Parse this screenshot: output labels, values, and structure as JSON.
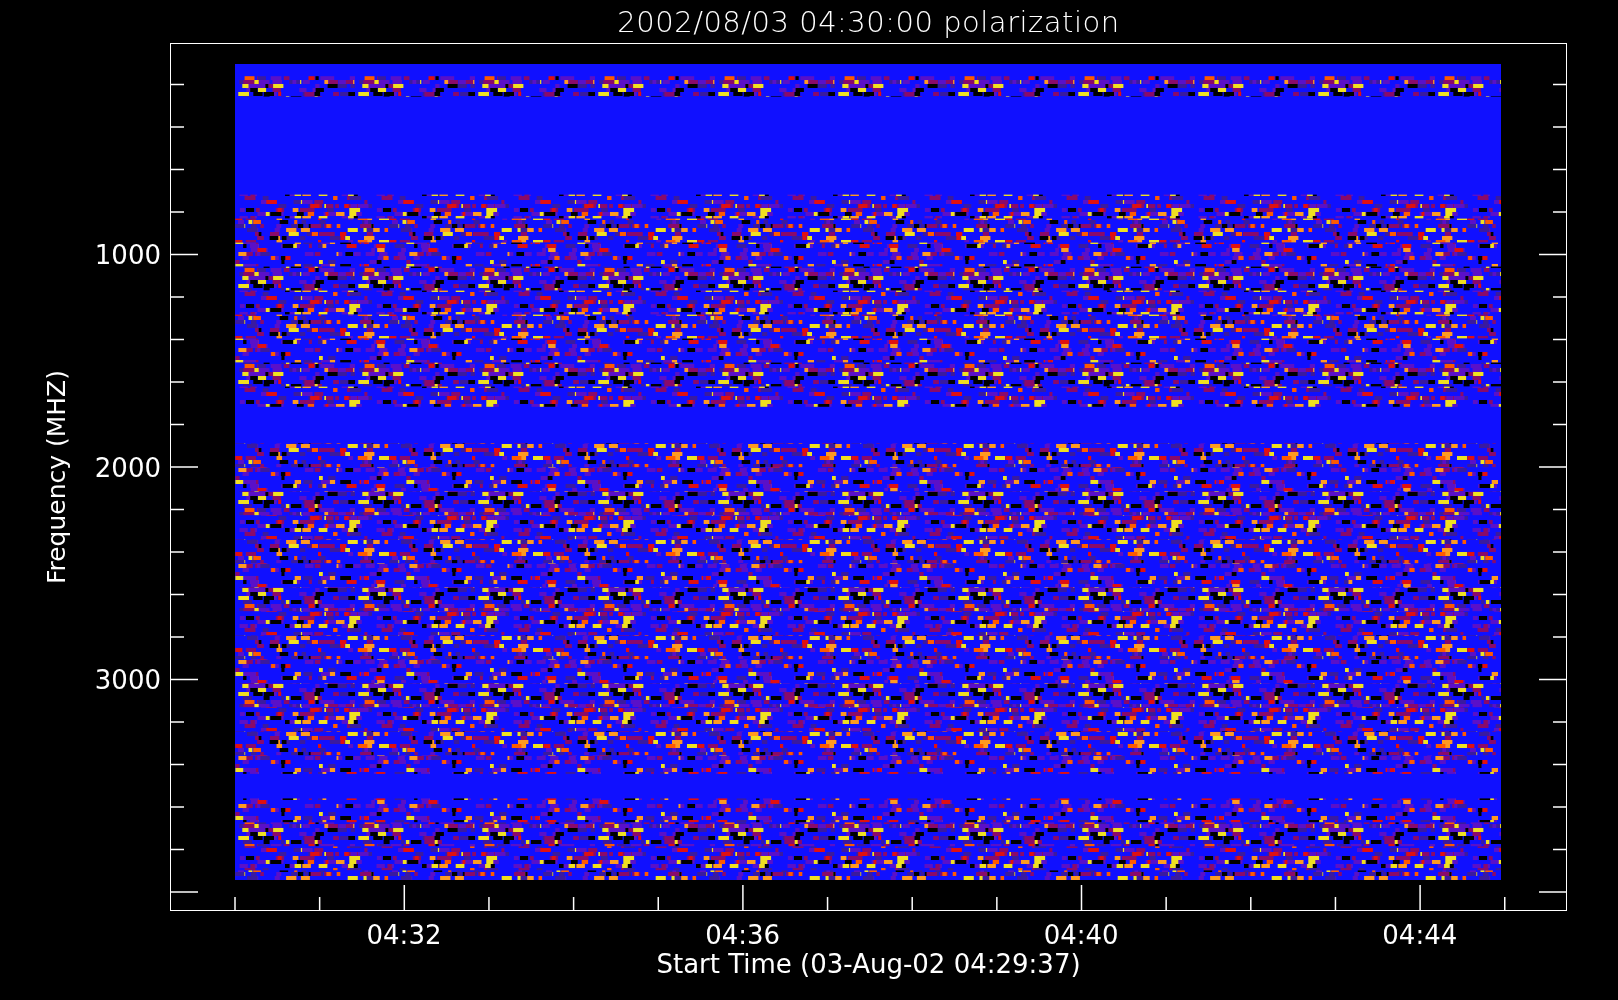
{
  "title": "2002/08/03 04:30:00 polarization",
  "y_axis": {
    "label": "Frequency (MHZ)",
    "tick_labels": [
      "1000",
      "2000",
      "3000"
    ]
  },
  "x_axis": {
    "label": "Start Time (03-Aug-02 04:29:37)",
    "tick_labels": [
      "04:32",
      "04:36",
      "04:40",
      "04:44"
    ]
  }
}
